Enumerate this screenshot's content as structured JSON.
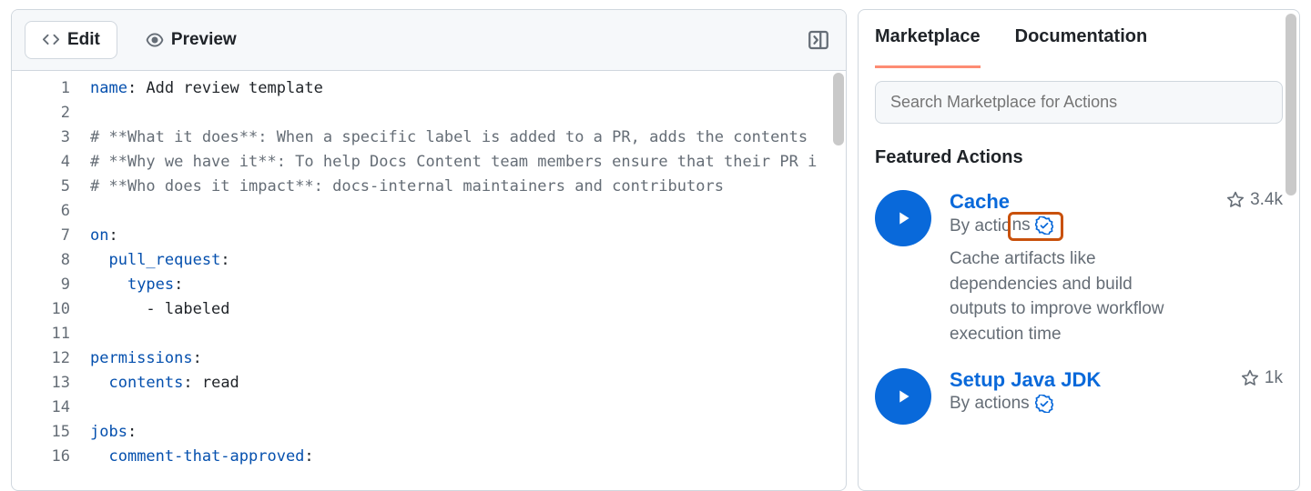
{
  "editor": {
    "tabs": {
      "edit": "Edit",
      "preview": "Preview"
    },
    "lines": [
      [
        {
          "t": "key",
          "v": "name"
        },
        {
          "t": "plain",
          "v": ": Add review template"
        }
      ],
      [],
      [
        {
          "t": "cmt",
          "v": "# **What it does**: When a specific label is added to a PR, adds the contents "
        }
      ],
      [
        {
          "t": "cmt",
          "v": "# **Why we have it**: To help Docs Content team members ensure that their PR i"
        }
      ],
      [
        {
          "t": "cmt",
          "v": "# **Who does it impact**: docs-internal maintainers and contributors"
        }
      ],
      [],
      [
        {
          "t": "key",
          "v": "on"
        },
        {
          "t": "plain",
          "v": ":"
        }
      ],
      [
        {
          "t": "plain",
          "v": "  "
        },
        {
          "t": "key",
          "v": "pull_request"
        },
        {
          "t": "plain",
          "v": ":"
        }
      ],
      [
        {
          "t": "plain",
          "v": "    "
        },
        {
          "t": "key",
          "v": "types"
        },
        {
          "t": "plain",
          "v": ":"
        }
      ],
      [
        {
          "t": "plain",
          "v": "      - labeled"
        }
      ],
      [],
      [
        {
          "t": "key",
          "v": "permissions"
        },
        {
          "t": "plain",
          "v": ":"
        }
      ],
      [
        {
          "t": "plain",
          "v": "  "
        },
        {
          "t": "key",
          "v": "contents"
        },
        {
          "t": "plain",
          "v": ": read"
        }
      ],
      [],
      [
        {
          "t": "key",
          "v": "jobs"
        },
        {
          "t": "plain",
          "v": ":"
        }
      ],
      [
        {
          "t": "plain",
          "v": "  "
        },
        {
          "t": "key",
          "v": "comment-that-approved"
        },
        {
          "t": "plain",
          "v": ":"
        }
      ]
    ]
  },
  "sidebar": {
    "tabs": {
      "marketplace": "Marketplace",
      "documentation": "Documentation"
    },
    "search_placeholder": "Search Marketplace for Actions",
    "section_title": "Featured Actions",
    "actions": [
      {
        "title": "Cache",
        "by_prefix": "By actio",
        "by_suffix": "ns",
        "stars": "3.4k",
        "desc": "Cache artifacts like dependencies and build outputs to improve workflow execution time",
        "highlight_verified": true
      },
      {
        "title": "Setup Java JDK",
        "by_prefix": "By actions",
        "by_suffix": "",
        "stars": "1k",
        "desc": "",
        "highlight_verified": false
      }
    ]
  }
}
